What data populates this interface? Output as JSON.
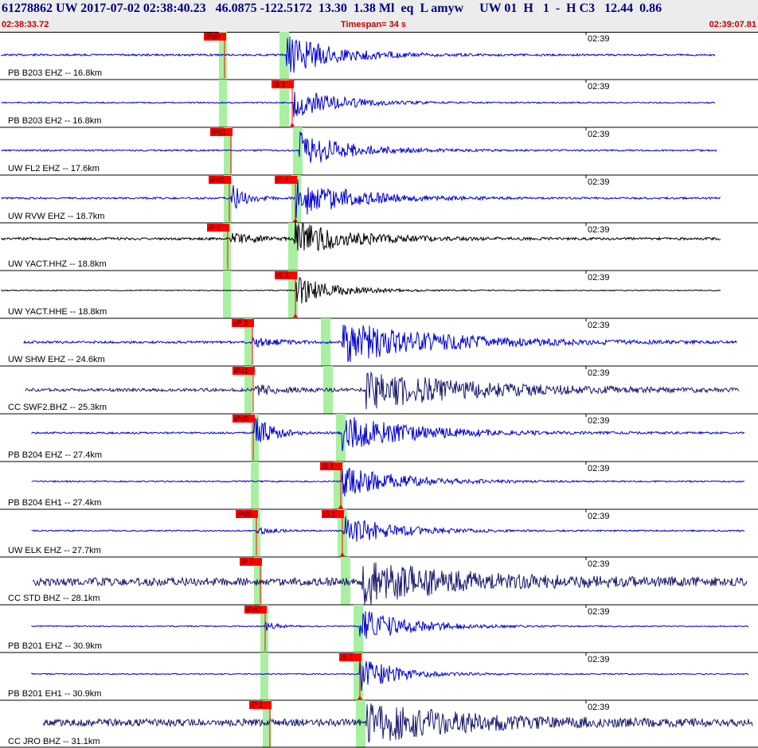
{
  "header": {
    "title": "61278862 UW 2017-07-02 02:38:40.23   46.0875 -122.5172  13.30  1.38 Ml  eq  L amyw     UW 01  H   1  -  H C3   12.44  0.86",
    "start_time": "02:38:33.72",
    "timespan": "Timespan=  34 s",
    "end_time": "02:39:07.81"
  },
  "colors": {
    "background": "#ffffff",
    "header_bg": "#ececec",
    "title_text": "#000080",
    "time_text": "#c00000",
    "trace_blue": "#0000d0",
    "trace_black": "#000000",
    "trace_navy": "#1a1a6e",
    "pick_red": "#ff0000",
    "window_green": "#a8f0a0"
  },
  "time_label": "02:39",
  "traces": [
    {
      "label": "PB B203 EHZ -- 16.8km",
      "color": "blue",
      "picks": [
        {
          "text": "iPd0",
          "phase": "P"
        }
      ]
    },
    {
      "label": "PB B203 EH2 -- 16.8km",
      "color": "blue",
      "picks": [
        {
          "text": "iS 1",
          "phase": "S"
        }
      ]
    },
    {
      "label": "UW FL2 EHZ -- 17.6km",
      "color": "blue",
      "picks": [
        {
          "text": "iPd1",
          "phase": "P"
        }
      ]
    },
    {
      "label": "UW RVW EHZ -- 18.7km",
      "color": "blue",
      "picks": [
        {
          "text": "iPd1",
          "phase": "P"
        },
        {
          "text": "iS 1",
          "phase": "S"
        }
      ]
    },
    {
      "label": "UW YACT.HHZ -- 18.8km",
      "color": "black",
      "picks": [
        {
          "text": "iP 1",
          "phase": "P"
        }
      ]
    },
    {
      "label": "UW YACT.HHE -- 18.8km",
      "color": "black",
      "picks": [
        {
          "text": "iS 1",
          "phase": "S"
        }
      ]
    },
    {
      "label": "UW SHW EHZ -- 24.6km",
      "color": "blue",
      "picks": [
        {
          "text": "eP 2",
          "phase": "P"
        }
      ]
    },
    {
      "label": "CC SWF2.BHZ -- 25.3km",
      "color": "navy",
      "picks": [
        {
          "text": "iPd1",
          "phase": "P"
        }
      ]
    },
    {
      "label": "PB B204 EHZ -- 27.4km",
      "color": "blue",
      "picks": [
        {
          "text": "iPd0",
          "phase": "P"
        }
      ]
    },
    {
      "label": "PB B204 EH1 -- 27.4km",
      "color": "blue",
      "picks": [
        {
          "text": "iS 1",
          "phase": "S"
        }
      ]
    },
    {
      "label": "UW ELK EHZ -- 27.7km",
      "color": "blue",
      "picks": [
        {
          "text": "iPd0",
          "phase": "P"
        },
        {
          "text": "iS 1",
          "phase": "S"
        }
      ]
    },
    {
      "label": "CC STD BHZ -- 28.1km",
      "color": "navy",
      "picks": [
        {
          "text": "iP 1",
          "phase": "P"
        }
      ]
    },
    {
      "label": "PB B201 EHZ -- 30.9km",
      "color": "blue",
      "picks": [
        {
          "text": "iPd0",
          "phase": "P"
        }
      ]
    },
    {
      "label": "PB B201 EH1 -- 30.9km",
      "color": "blue",
      "picks": [
        {
          "text": "iS 1",
          "phase": "S"
        }
      ]
    },
    {
      "label": "CC JRO BHZ -- 31.1km",
      "color": "navy",
      "picks": [
        {
          "text": "iP 1",
          "phase": "P"
        }
      ]
    }
  ]
}
